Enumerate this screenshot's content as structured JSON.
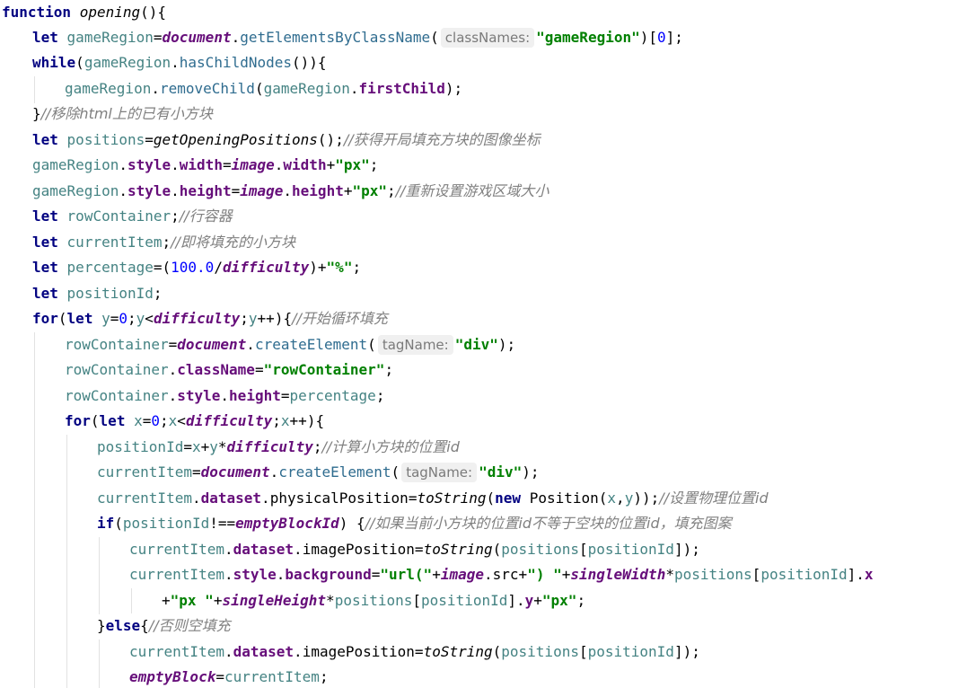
{
  "code": {
    "l1": {
      "kw": "function",
      "name": "opening",
      "tail": "(){"
    },
    "l2": {
      "kw": "let",
      "var": "gameRegion",
      "eq": "=",
      "obj": "document",
      "dot": ".",
      "method": "getElementsByClassName",
      "open": "(",
      "hint": "classNames:",
      "str": "\"gameRegion\"",
      "close": ")[",
      "num": "0",
      "end": "];"
    },
    "l3": {
      "kw": "while",
      "open": "(",
      "var": "gameRegion",
      "dot": ".",
      "method": "hasChildNodes",
      "tail": "()){"
    },
    "l4": {
      "var": "gameRegion",
      "dot": ".",
      "method": "removeChild",
      "open": "(",
      "var2": "gameRegion",
      "dot2": ".",
      "field": "firstChild",
      "end": ");"
    },
    "l5": {
      "tail": "}",
      "comment": "//移除html上的已有小方块"
    },
    "l6": {
      "kw": "let",
      "var": "positions",
      "eq": "=",
      "fn": "getOpeningPositions",
      "tail": "();",
      "comment": "//获得开局填充方块的图像坐标"
    },
    "l7": {
      "var": "gameRegion",
      "dot": ".",
      "field": "style",
      "dot2": ".",
      "field2": "width",
      "eq": "=",
      "glob": "image",
      "dot3": ".",
      "field3": "width",
      "plus": "+",
      "str": "\"px\"",
      "end": ";"
    },
    "l8": {
      "var": "gameRegion",
      "dot": ".",
      "field": "style",
      "dot2": ".",
      "field2": "height",
      "eq": "=",
      "glob": "image",
      "dot3": ".",
      "field3": "height",
      "plus": "+",
      "str": "\"px\"",
      "end": ";",
      "comment": "//重新设置游戏区域大小"
    },
    "l9": {
      "kw": "let",
      "var": "rowContainer",
      "end": ";",
      "comment": "//行容器"
    },
    "l10": {
      "kw": "let",
      "var": "currentItem",
      "end": ";",
      "comment": "//即将填充的小方块"
    },
    "l11": {
      "kw": "let",
      "var": "percentage",
      "eq": "=(",
      "num": "100.0",
      "slash": "/",
      "glob": "difficulty",
      "close": ")+",
      "str": "\"%\"",
      "end": ";"
    },
    "l12": {
      "kw": "let",
      "var": "positionId",
      "end": ";"
    },
    "l13": {
      "kw": "for",
      "open": "(",
      "kw2": "let",
      "var": "y",
      "eq": "=",
      "num": "0",
      "semi": ";",
      "var2": "y",
      "lt": "<",
      "glob": "difficulty",
      "semi2": ";",
      "var3": "y",
      "tail": "++){",
      "comment": "//开始循环填充"
    },
    "l14": {
      "var": "rowContainer",
      "eq": "=",
      "obj": "document",
      "dot": ".",
      "method": "createElement",
      "open": "(",
      "hint": "tagName:",
      "str": "\"div\"",
      "end": ");"
    },
    "l15": {
      "var": "rowContainer",
      "dot": ".",
      "field": "className",
      "eq": "=",
      "str": "\"rowContainer\"",
      "end": ";"
    },
    "l16": {
      "var": "rowContainer",
      "dot": ".",
      "field": "style",
      "dot2": ".",
      "field2": "height",
      "eq": "=",
      "var2": "percentage",
      "end": ";"
    },
    "l17": {
      "kw": "for",
      "open": "(",
      "kw2": "let",
      "var": "x",
      "eq": "=",
      "num": "0",
      "semi": ";",
      "var2": "x",
      "lt": "<",
      "glob": "difficulty",
      "semi2": ";",
      "var3": "x",
      "tail": "++){"
    },
    "l18": {
      "var": "positionId",
      "eq": "=",
      "var2": "x",
      "plus": "+",
      "var3": "y",
      "star": "*",
      "glob": "difficulty",
      "end": ";",
      "comment": "//计算小方块的位置id"
    },
    "l19": {
      "var": "currentItem",
      "eq": "=",
      "obj": "document",
      "dot": ".",
      "method": "createElement",
      "open": "(",
      "hint": "tagName:",
      "str": "\"div\"",
      "end": ");"
    },
    "l20": {
      "var": "currentItem",
      "dot": ".",
      "field": "dataset",
      "dot2": ".",
      "prop": "physicalPosition",
      "eq": "=",
      "fn": "toString",
      "open": "(",
      "kw": "new",
      "cls": " Position",
      "open2": "(",
      "var2": "x",
      "comma": ",",
      "var3": "y",
      "end": "));",
      "comment": "//设置物理位置id"
    },
    "l21": {
      "kw": "if",
      "open": "(",
      "var": "positionId",
      "neq": "!==",
      "glob": "emptyBlockId",
      "close": ") {",
      "comment": "//如果当前小方块的位置id不等于空块的位置id，填充图案"
    },
    "l22": {
      "var": "currentItem",
      "dot": ".",
      "field": "dataset",
      "dot2": ".",
      "prop": "imagePosition",
      "eq": "=",
      "fn": "toString",
      "open": "(",
      "var2": "positions",
      "br": "[",
      "var3": "positionId",
      "end": "]);"
    },
    "l23": {
      "var": "currentItem",
      "dot": ".",
      "field": "style",
      "dot2": ".",
      "field2": "background",
      "eq": "=",
      "str": "\"url(\"",
      "plus": "+",
      "glob": "image",
      "dot3": ".",
      "prop": "src",
      "plus2": "+",
      "str2": "\") \"",
      "plus3": "+",
      "glob2": "singleWidth",
      "star": "*",
      "var2": "positions",
      "br": "[",
      "var3": "positionId",
      "br2": "].",
      "field3": "x"
    },
    "l24": {
      "plus": "+",
      "str": "\"px \"",
      "plus2": "+",
      "glob": "singleHeight",
      "star": "*",
      "var": "positions",
      "br": "[",
      "var2": "positionId",
      "br2": "].",
      "field": "y",
      "plus3": "+",
      "str2": "\"px\"",
      "end": ";"
    },
    "l25": {
      "tail": "}",
      "kw": "else",
      "open": "{",
      "comment": "//否则空填充"
    },
    "l26": {
      "var": "currentItem",
      "dot": ".",
      "field": "dataset",
      "dot2": ".",
      "prop": "imagePosition",
      "eq": "=",
      "fn": "toString",
      "open": "(",
      "var2": "positions",
      "br": "[",
      "var3": "positionId",
      "end": "]);"
    },
    "l27": {
      "glob": "emptyBlock",
      "eq": "=",
      "var": "currentItem",
      "end": ";"
    }
  },
  "colors": {
    "keyword": "#000080",
    "variable": "#458383",
    "field": "#660e7a",
    "string": "#008000",
    "number": "#0000ff",
    "comment": "#808080",
    "hint_bg": "#f0f0f0"
  }
}
